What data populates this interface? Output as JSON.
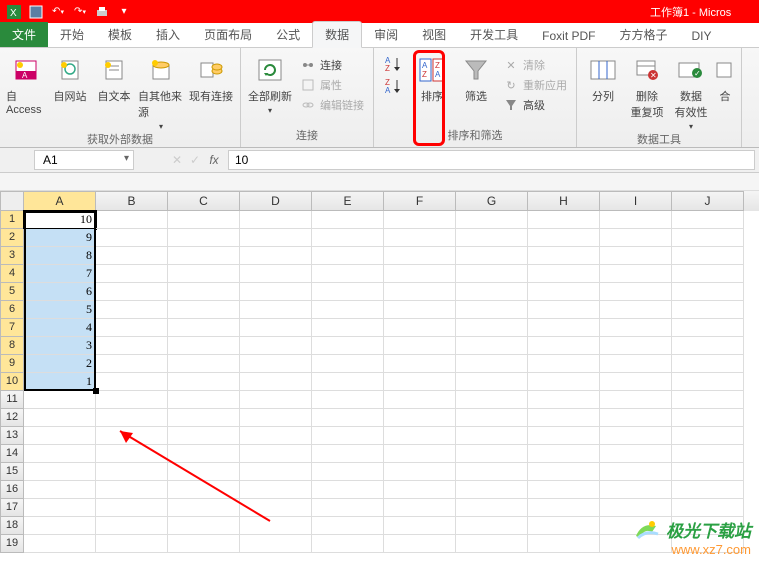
{
  "title": "工作簿1 - Micros",
  "tabs": {
    "file": "文件",
    "items": [
      "开始",
      "模板",
      "插入",
      "页面布局",
      "公式",
      "数据",
      "审阅",
      "视图",
      "开发工具",
      "Foxit PDF",
      "方方格子",
      "DIY"
    ]
  },
  "activeTab": "数据",
  "ribbon": {
    "group1": {
      "label": "获取外部数据",
      "btns": [
        "自 Access",
        "自网站",
        "自文本",
        "自其他来源",
        "现有连接"
      ]
    },
    "group2": {
      "label": "连接",
      "refresh": "全部刷新",
      "conn": "连接",
      "prop": "属性",
      "editlink": "编辑链接"
    },
    "group3": {
      "label": "排序和筛选",
      "sort": "排序",
      "filter": "筛选",
      "clear": "清除",
      "reapply": "重新应用",
      "adv": "高级"
    },
    "group4": {
      "label": "数据工具",
      "cols": "分列",
      "dedup": "删除\n重复项",
      "valid": "数据\n有效性",
      "merge": "合"
    }
  },
  "nameBox": "A1",
  "formula": "10",
  "columns": [
    "A",
    "B",
    "C",
    "D",
    "E",
    "F",
    "G",
    "H",
    "I",
    "J"
  ],
  "selCol": "A",
  "rowCount": 19,
  "selRowsFrom": 1,
  "selRowsTo": 10,
  "cells": {
    "A1": "10",
    "A2": "9",
    "A3": "8",
    "A4": "7",
    "A5": "6",
    "A6": "5",
    "A7": "4",
    "A8": "3",
    "A9": "2",
    "A10": "1"
  },
  "watermark": {
    "name": "极光下载站",
    "url": "www.xz7.com"
  }
}
